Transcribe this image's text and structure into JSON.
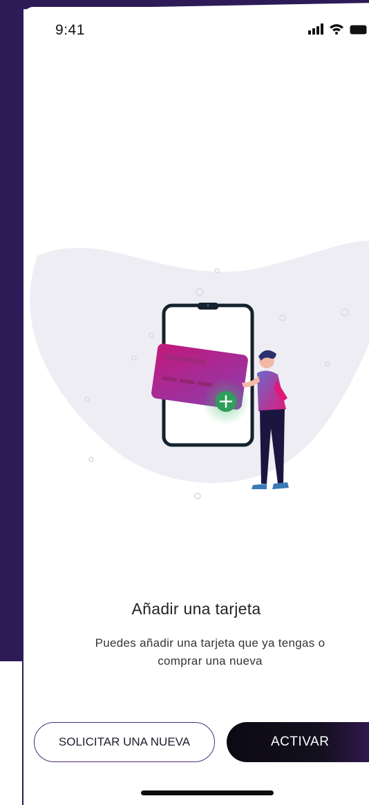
{
  "status_bar": {
    "time": "9:41"
  },
  "content": {
    "title": "Añadir una tarjeta",
    "subtitle_line1": "Puedes añadir una tarjeta que ya tengas o",
    "subtitle_line2": "comprar una nueva"
  },
  "actions": {
    "secondary_label": "SOLICITAR UNA NUEVA",
    "primary_label": "ACTIVAR"
  },
  "colors": {
    "brand_purple": "#2d1b57",
    "card_gradient_start": "#c2187a",
    "card_gradient_end": "#8a3fb0",
    "plus_green": "#3dbb6a",
    "primary_button": "#0c0a14"
  }
}
